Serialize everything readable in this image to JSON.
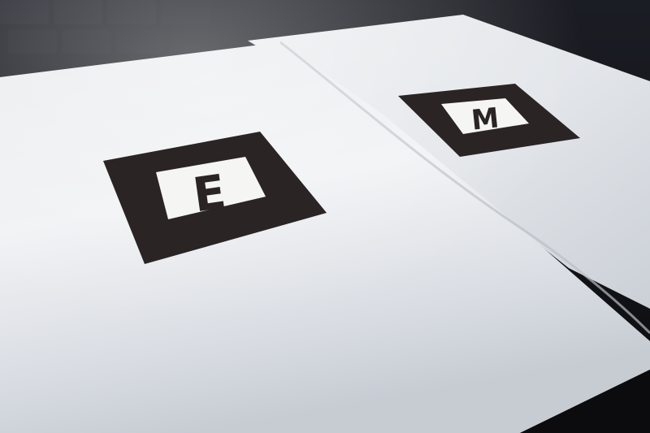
{
  "markers": [
    {
      "letter": "E"
    },
    {
      "letter": "M"
    }
  ],
  "colors": {
    "background": "#0b0b0d",
    "paper_light": "#eef0f2",
    "paper_shadow": "#cfd4da",
    "marker_ink": "#2a2424",
    "marker_inner": "#f6f6f4"
  }
}
